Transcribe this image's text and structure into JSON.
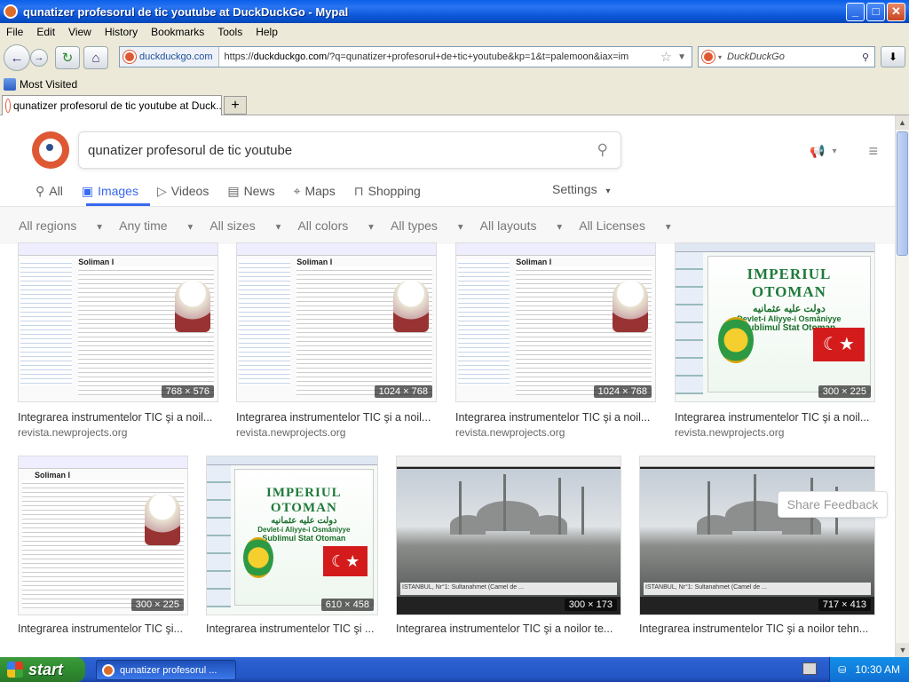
{
  "window": {
    "title": "qunatizer profesorul de tic youtube at DuckDuckGo - Mypal",
    "min": "_",
    "max": "□",
    "close": "✕"
  },
  "menu": [
    "File",
    "Edit",
    "View",
    "History",
    "Bookmarks",
    "Tools",
    "Help"
  ],
  "nav": {
    "site_label": "duckduckgo.com",
    "url_prefix": "https://",
    "url_domain": "duckduckgo.com",
    "url_rest": "/?q=qunatizer+profesorul+de+tic+youtube&kp=1&t=palemoon&iax=im",
    "search_engine": "DuckDuckGo"
  },
  "bookmarks": {
    "most_visited": "Most Visited"
  },
  "tabs": [
    {
      "label": "qunatizer profesorul de tic youtube at Duck..."
    }
  ],
  "search": {
    "query": "qunatizer profesorul de tic youtube"
  },
  "vertical_tabs": [
    {
      "label": "All",
      "icon": "search-icon"
    },
    {
      "label": "Images",
      "icon": "image-icon",
      "active": true
    },
    {
      "label": "Videos",
      "icon": "play-icon"
    },
    {
      "label": "News",
      "icon": "newspaper-icon"
    },
    {
      "label": "Maps",
      "icon": "map-pin-icon"
    },
    {
      "label": "Shopping",
      "icon": "shopping-bag-icon"
    }
  ],
  "settings_label": "Settings",
  "filters": [
    "All regions",
    "Any time",
    "All sizes",
    "All colors",
    "All types",
    "All layouts",
    "All Licenses"
  ],
  "results": [
    {
      "title": "Integrarea instrumentelor TIC şi a noil...",
      "source": "revista.newprojects.org",
      "dims": "768 × 576",
      "kind": "wiki"
    },
    {
      "title": "Integrarea instrumentelor TIC şi a noil...",
      "source": "revista.newprojects.org",
      "dims": "1024 × 768",
      "kind": "wiki"
    },
    {
      "title": "Integrarea instrumentelor TIC şi a noil...",
      "source": "revista.newprojects.org",
      "dims": "1024 × 768",
      "kind": "wiki"
    },
    {
      "title": "Integrarea instrumentelor TIC şi a noil...",
      "source": "revista.newprojects.org",
      "dims": "300 × 225",
      "kind": "ppt"
    },
    {
      "title": "Integrarea instrumentelor TIC şi...",
      "source": "",
      "dims": "300 × 225",
      "kind": "wiki"
    },
    {
      "title": "Integrarea instrumentelor TIC şi ...",
      "source": "",
      "dims": "610 × 458",
      "kind": "ppt"
    },
    {
      "title": "Integrarea instrumentelor TIC şi a noilor te...",
      "source": "",
      "dims": "300 × 173",
      "kind": "yt"
    },
    {
      "title": "Integrarea instrumentelor TIC şi a noilor tehn...",
      "source": "",
      "dims": "717 × 413",
      "kind": "yt"
    }
  ],
  "thumb_text": {
    "wiki_heading": "Soliman I",
    "ppt_title": "IMPERIUL OTOMAN",
    "ppt_arabic": "دولت عليه عثمانيه",
    "ppt_sub1": "Devlet-i Aliyye-i Osmâniyye",
    "ppt_sub2": "Sublimul Stat Otoman",
    "ppt_star": "☾★",
    "yt_caption": "ISTANBUL, Nr°1: Sultanahmet (Camel de ..."
  },
  "feedback": "Share Feedback",
  "taskbar": {
    "start": "start",
    "app": "qunatizer profesorul ...",
    "clock": "10:30 AM"
  },
  "colors": {
    "ddg_orange": "#de5833",
    "active_tab": "#3969ef",
    "xp_blue": "#245edb"
  }
}
